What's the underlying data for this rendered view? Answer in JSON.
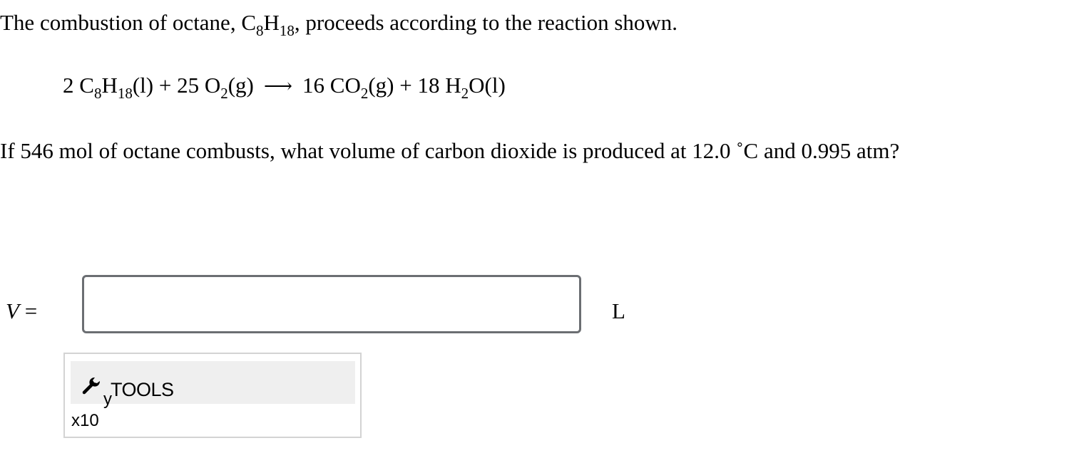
{
  "intro": {
    "prefix": "The combustion of octane, C",
    "sub1": "8",
    "mid": "H",
    "sub2": "18",
    "suffix": ", proceeds according to the reaction shown."
  },
  "equation": {
    "t1": "2 C",
    "s1": "8",
    "t2": "H",
    "s2": "18",
    "t3": "(l) + 25 O",
    "s3": "2",
    "t4": "(g)",
    "arrow": "⟶",
    "t5": "16 CO",
    "s4": "2",
    "t6": "(g) + 18 H",
    "s5": "2",
    "t7": "O(l)"
  },
  "question": "If 546 mol of octane combusts, what volume of carbon dioxide is produced at 12.0 ˚C and 0.995 atm?",
  "answer": {
    "variable": "V",
    "equals": " =",
    "value": "",
    "placeholder": "",
    "unit": "L"
  },
  "tools": {
    "label": "TOOLS",
    "icon": "wrench-icon",
    "sci_base": "x10",
    "sci_exp": "y"
  }
}
